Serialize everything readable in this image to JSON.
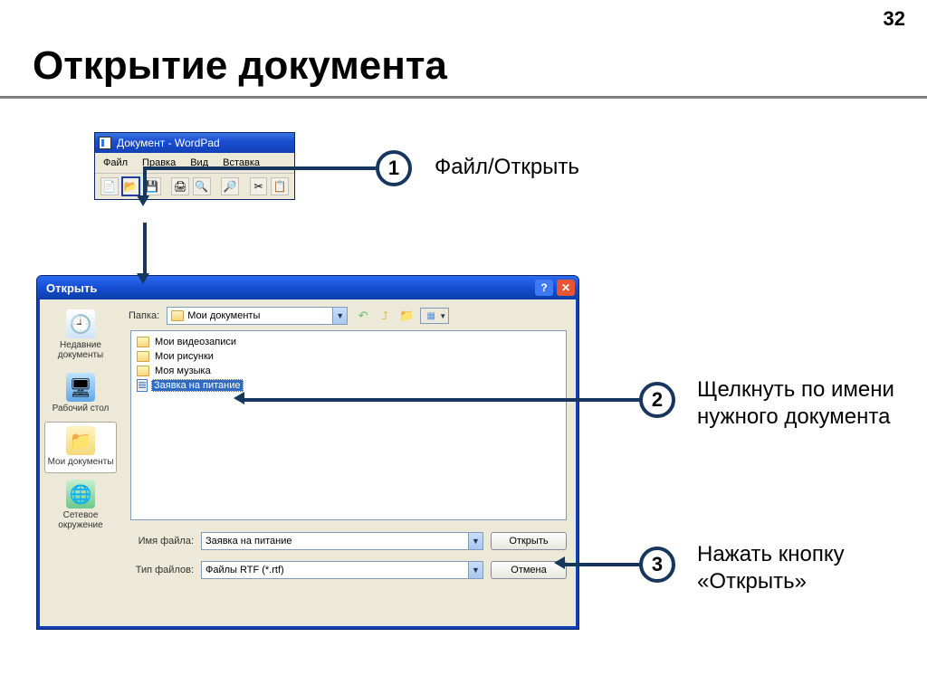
{
  "page_number": "32",
  "slide_title": "Открытие документа",
  "wordpad": {
    "title": "Документ - WordPad",
    "menu": [
      "Файл",
      "Правка",
      "Вид",
      "Вставка"
    ]
  },
  "callouts": {
    "c1": {
      "num": "1",
      "text": "Файл/Открыть"
    },
    "c2": {
      "num": "2",
      "text": "Щелкнуть по имени нужного документа"
    },
    "c3": {
      "num": "3",
      "text": "Нажать кнопку «Открыть»"
    }
  },
  "dialog": {
    "title": "Открыть",
    "folder_label": "Папка:",
    "folder_value": "Мои документы",
    "sidebar": {
      "recent": "Недавние документы",
      "desktop": "Рабочий стол",
      "mydocs": "Мои документы",
      "network": "Сетевое окружение"
    },
    "files": {
      "f1": "Мои видеозаписи",
      "f2": "Мои рисунки",
      "f3": "Моя музыка",
      "f4": "Заявка на питание"
    },
    "filename_label": "Имя файла:",
    "filename_value": "Заявка на питание",
    "filetype_label": "Тип файлов:",
    "filetype_value": "Файлы RTF (*.rtf)",
    "btn_open": "Открыть",
    "btn_cancel": "Отмена"
  }
}
